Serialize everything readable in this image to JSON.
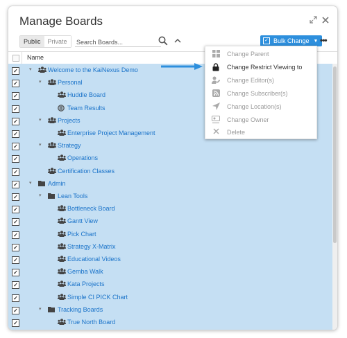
{
  "window": {
    "title": "Manage Boards"
  },
  "toolbar": {
    "public_label": "Public",
    "private_label": "Private",
    "search_placeholder": "Search Boards...",
    "bulk_label": "Bulk Change"
  },
  "table": {
    "column_name": "Name"
  },
  "tree": [
    {
      "label": "Welcome to the KaiNexus Demo",
      "level": 1,
      "icon": "team-icon",
      "toggle": "expanded",
      "checked": true
    },
    {
      "label": "Personal",
      "level": 2,
      "icon": "team-icon",
      "toggle": "expanded",
      "checked": true
    },
    {
      "label": "Huddle Board",
      "level": 3,
      "icon": "team-icon",
      "toggle": "none",
      "checked": true
    },
    {
      "label": "Team Results",
      "level": 3,
      "icon": "globe-icon",
      "toggle": "none",
      "checked": true
    },
    {
      "label": "Projects",
      "level": 2,
      "icon": "team-icon",
      "toggle": "expanded",
      "checked": true
    },
    {
      "label": "Enterprise Project Management",
      "level": 3,
      "icon": "team-icon",
      "toggle": "none",
      "checked": true
    },
    {
      "label": "Strategy",
      "level": 2,
      "icon": "team-icon",
      "toggle": "expanded",
      "checked": true
    },
    {
      "label": "Operations",
      "level": 3,
      "icon": "team-icon",
      "toggle": "none",
      "checked": true
    },
    {
      "label": "Certification Classes",
      "level": 2,
      "icon": "team-icon",
      "toggle": "none",
      "checked": true
    },
    {
      "label": "Admin",
      "level": 1,
      "icon": "folder-icon",
      "toggle": "expanded",
      "checked": true
    },
    {
      "label": "Lean Tools",
      "level": 2,
      "icon": "folder-icon",
      "toggle": "expanded",
      "checked": true
    },
    {
      "label": "Bottleneck Board",
      "level": 3,
      "icon": "team-icon",
      "toggle": "none",
      "checked": true
    },
    {
      "label": "Gantt View",
      "level": 3,
      "icon": "team-icon",
      "toggle": "none",
      "checked": true
    },
    {
      "label": "Pick Chart",
      "level": 3,
      "icon": "team-icon",
      "toggle": "none",
      "checked": true
    },
    {
      "label": "Strategy X-Matrix",
      "level": 3,
      "icon": "team-icon",
      "toggle": "none",
      "checked": true
    },
    {
      "label": "Educational Videos",
      "level": 3,
      "icon": "team-icon",
      "toggle": "none",
      "checked": true
    },
    {
      "label": "Gemba Walk",
      "level": 3,
      "icon": "team-icon",
      "toggle": "none",
      "checked": true
    },
    {
      "label": "Kata Projects",
      "level": 3,
      "icon": "team-icon",
      "toggle": "none",
      "checked": true
    },
    {
      "label": "Simple CI PICK Chart",
      "level": 3,
      "icon": "team-icon",
      "toggle": "none",
      "checked": true
    },
    {
      "label": "Tracking Boards",
      "level": 2,
      "icon": "folder-icon",
      "toggle": "expanded",
      "checked": true
    },
    {
      "label": "True North Board",
      "level": 3,
      "icon": "team-icon",
      "toggle": "none",
      "checked": true
    }
  ],
  "menu": [
    {
      "label": "Change Parent",
      "icon": "grid-icon",
      "enabled": false
    },
    {
      "label": "Change Restrict Viewing to",
      "icon": "lock-icon",
      "enabled": true
    },
    {
      "label": "Change Editor(s)",
      "icon": "user-edit-icon",
      "enabled": false
    },
    {
      "label": "Change Subscriber(s)",
      "icon": "rss-icon",
      "enabled": false
    },
    {
      "label": "Change Location(s)",
      "icon": "location-arrow-icon",
      "enabled": false
    },
    {
      "label": "Change Owner",
      "icon": "owner-icon",
      "enabled": false
    },
    {
      "label": "Delete",
      "icon": "close-icon",
      "enabled": false
    }
  ],
  "colors": {
    "accent": "#2d8fdd",
    "selection": "#c5dff3",
    "link": "#1a73c9"
  }
}
